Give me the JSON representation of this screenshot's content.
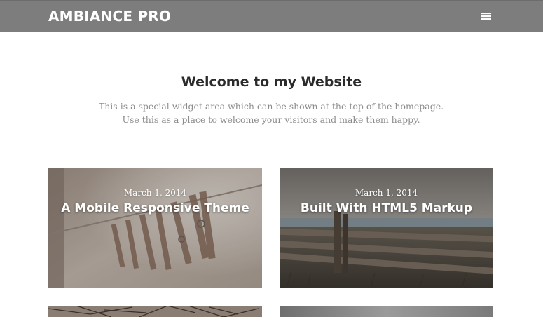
{
  "header": {
    "site_title": "AMBIANCE PRO",
    "menu_icon": "hamburger-menu-icon",
    "background_color": "#7d7d7d"
  },
  "welcome": {
    "title": "Welcome to my Website",
    "text": "This is a special widget area which can be shown at the top of the homepage. Use this as a place to welcome your visitors and make them happy."
  },
  "posts": [
    {
      "date": "March 1, 2014",
      "title": "A Mobile Responsive Theme",
      "image": "clothespins-photo"
    },
    {
      "date": "March 1, 2014",
      "title": "Built With HTML5 Markup",
      "image": "wooden-fence-photo"
    },
    {
      "date": "",
      "title": "",
      "image": "tree-branches-photo"
    },
    {
      "date": "",
      "title": "",
      "image": "sky-photo"
    }
  ]
}
